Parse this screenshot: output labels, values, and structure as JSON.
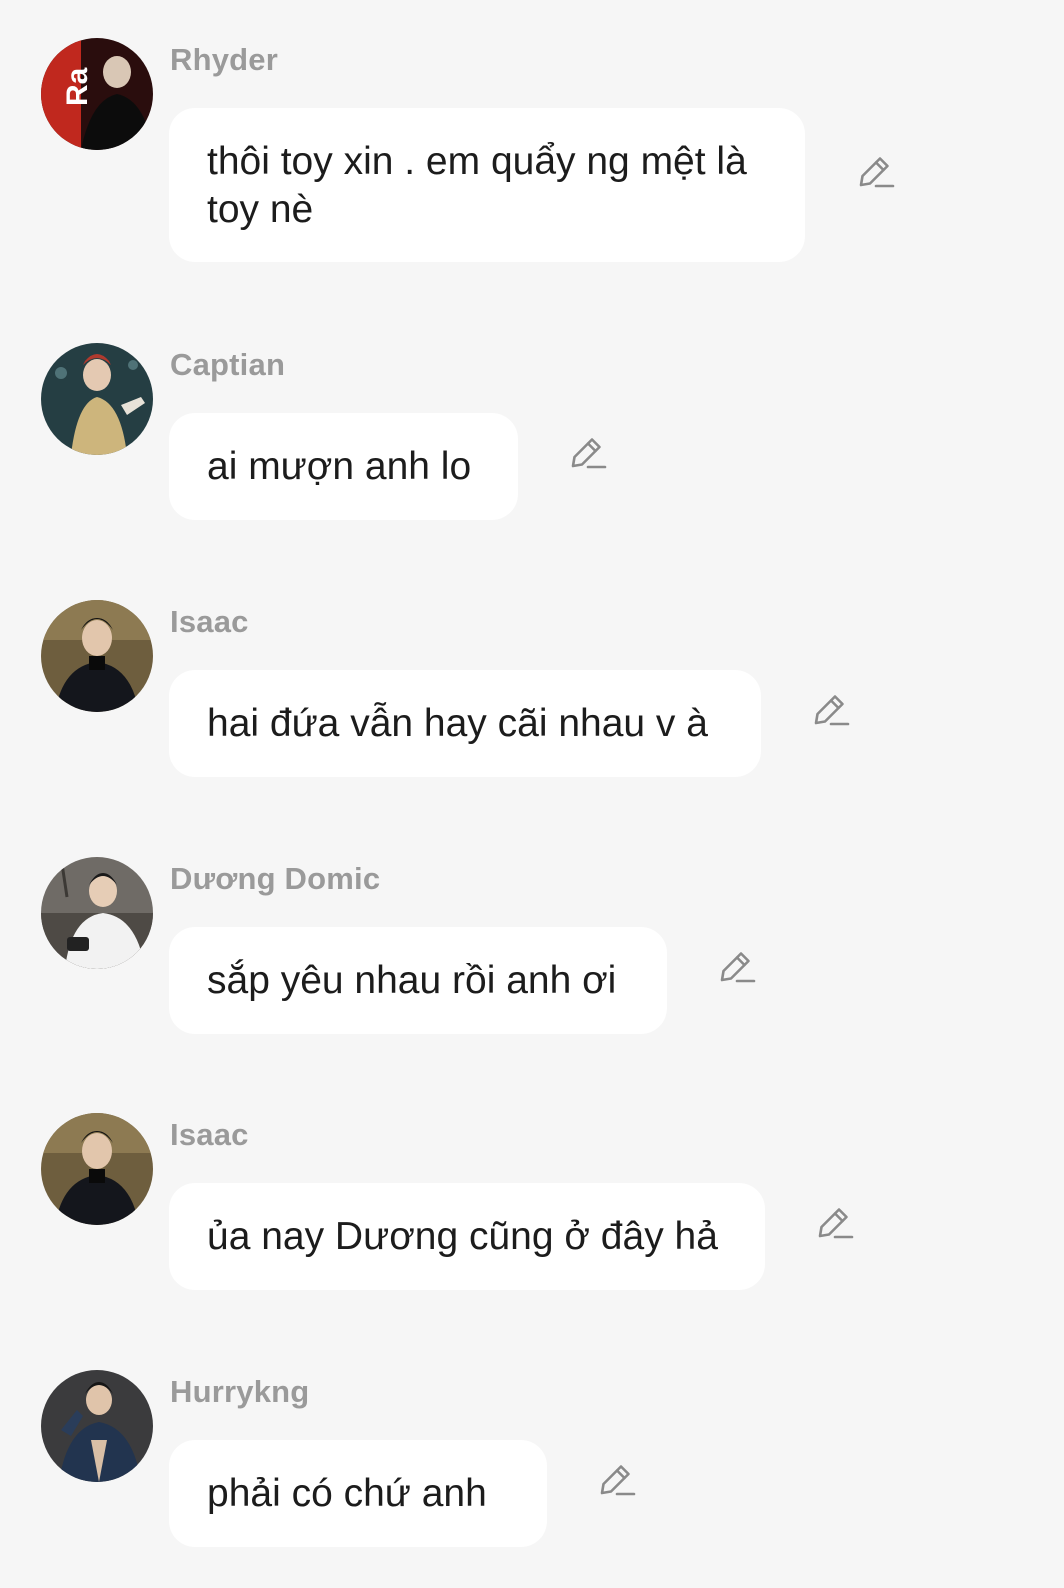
{
  "messages": [
    {
      "sender": "Rhyder",
      "text": "thôi toy xin . em quẩy ng mệt là toy nè",
      "avatar_colors": [
        "#3a1010",
        "#c0281e",
        "#0e0e0e"
      ]
    },
    {
      "sender": "Captian",
      "text": "ai mượn anh lo",
      "avatar_colors": [
        "#2c4a4e",
        "#d7c28a",
        "#e8e2d8"
      ]
    },
    {
      "sender": "Isaac",
      "text": "hai đứa vẫn hay cãi nhau v à",
      "avatar_colors": [
        "#7c6a45",
        "#15171d",
        "#e2c6ac"
      ]
    },
    {
      "sender": "Dương Domic",
      "text": "sắp yêu nhau rồi anh ơi",
      "avatar_colors": [
        "#6f6b66",
        "#f2f2f2",
        "#e6cdb6"
      ]
    },
    {
      "sender": "Isaac",
      "text": "ủa nay Dương cũng ở đây hả",
      "avatar_colors": [
        "#7c6a45",
        "#15171d",
        "#e2c6ac"
      ]
    },
    {
      "sender": "Hurrykng",
      "text": "phải có chứ anh",
      "avatar_colors": [
        "#3b3b3d",
        "#22344f",
        "#e0c4aa"
      ]
    }
  ],
  "icons": {
    "edit": "pencil-edit-icon"
  }
}
